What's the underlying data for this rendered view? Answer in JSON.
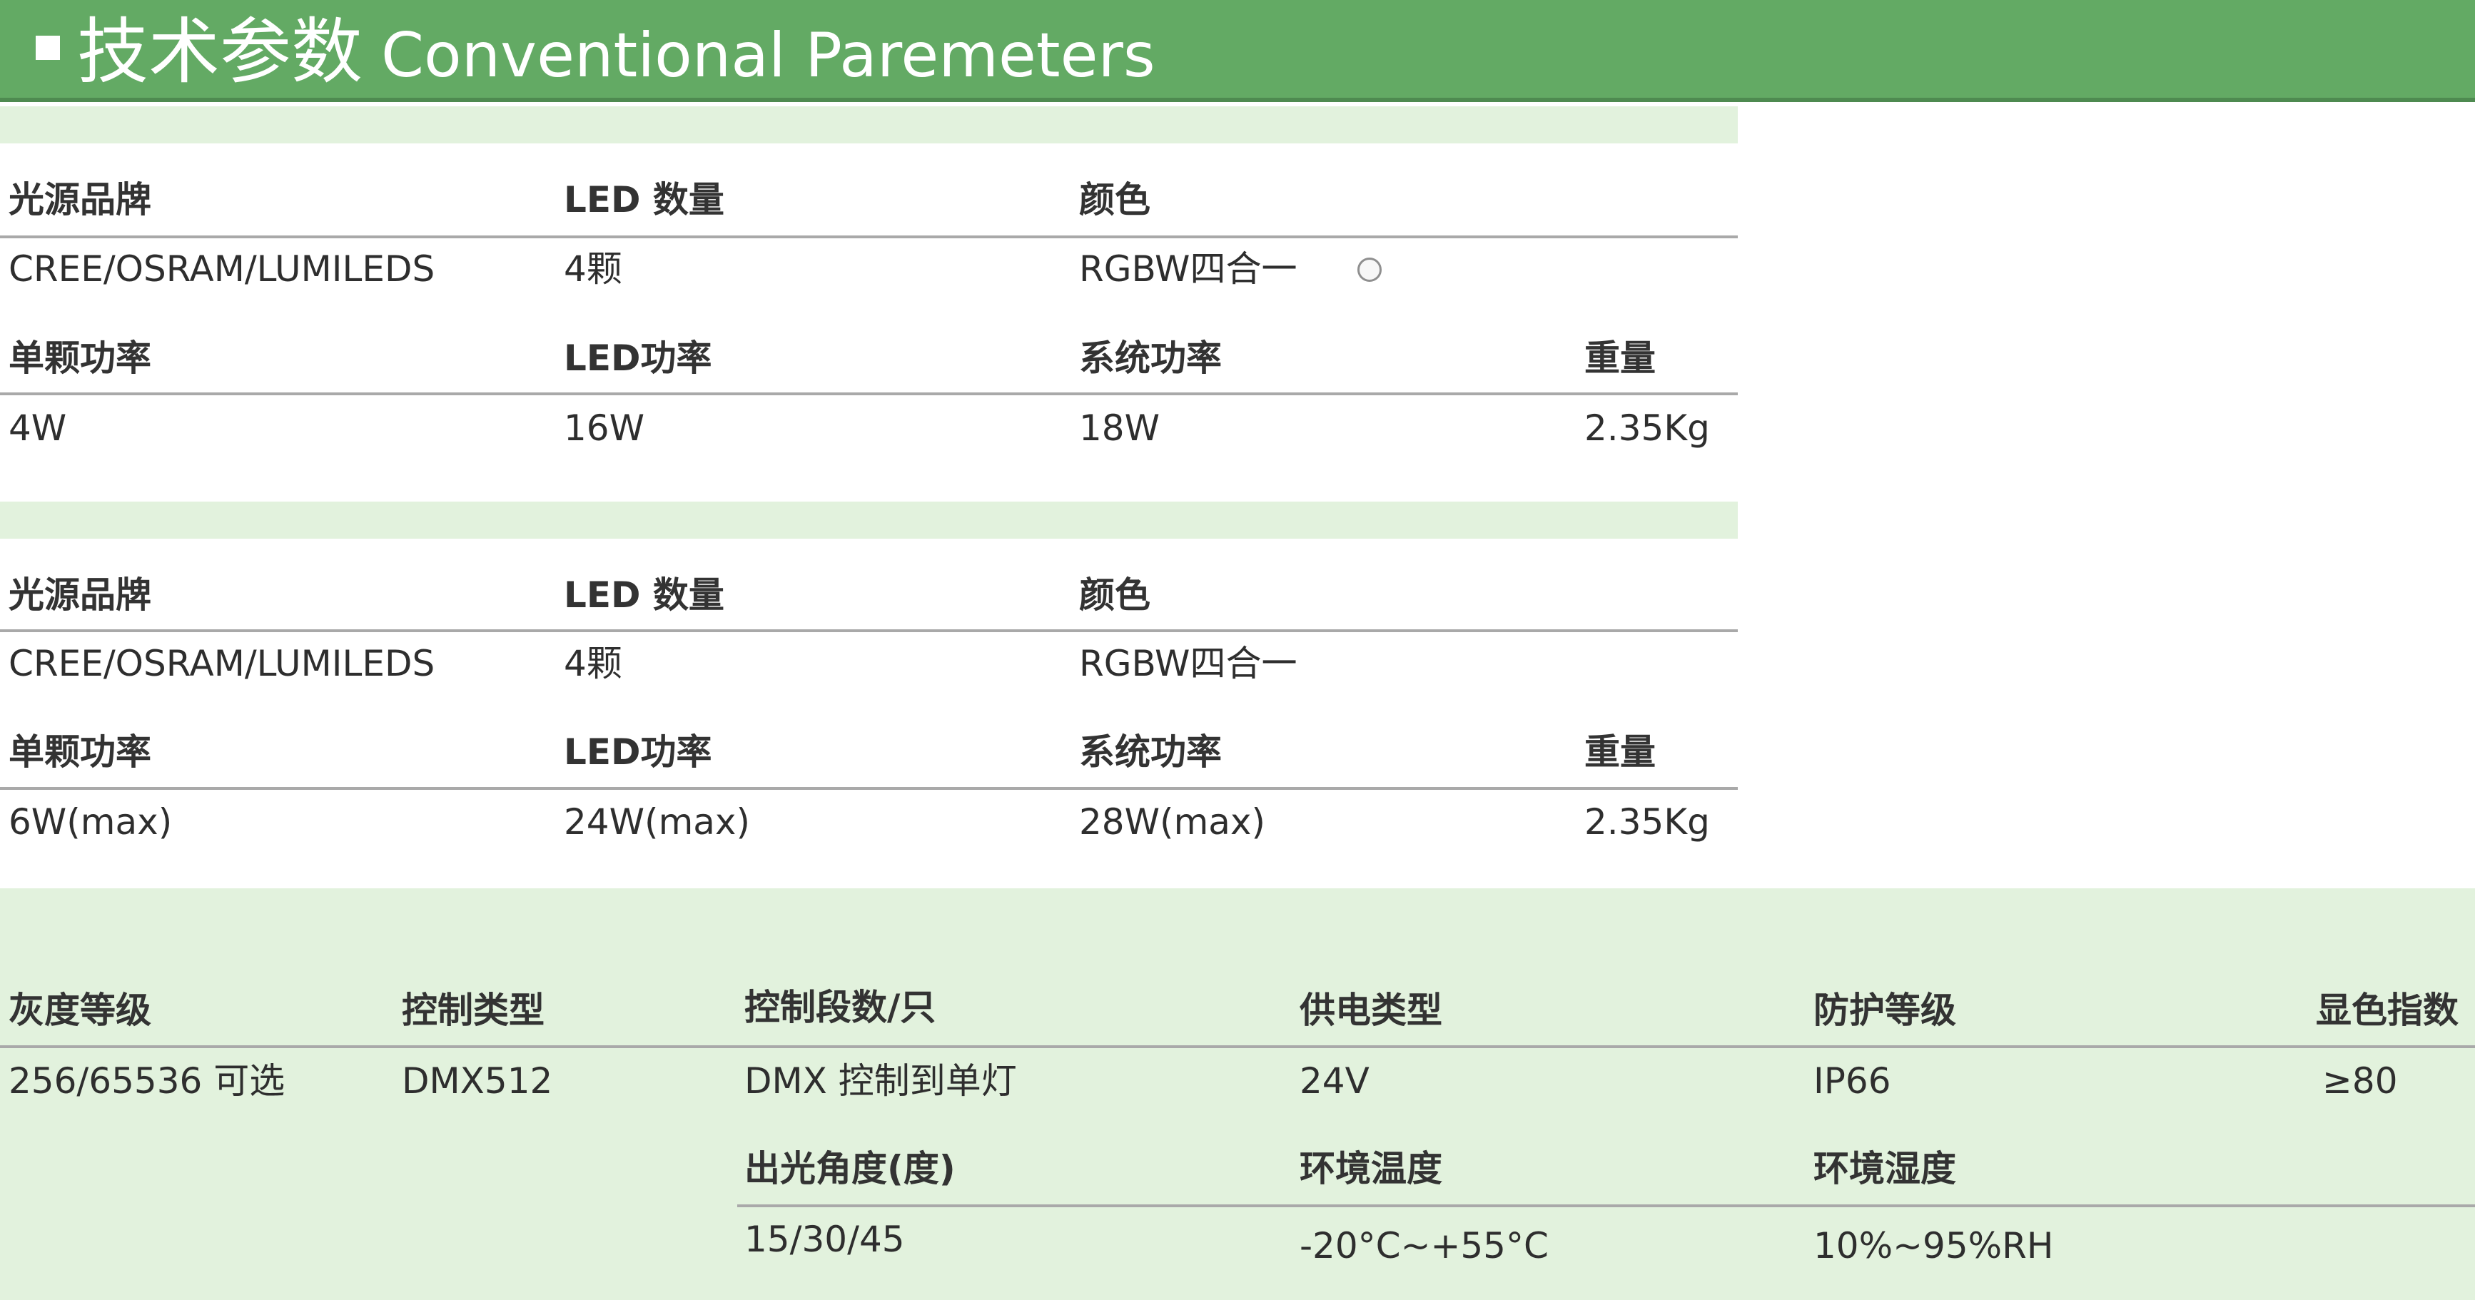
{
  "header": {
    "title_cn": "技术参数",
    "title_en": "Conventional Paremeters",
    "accent_color": "#63aa64"
  },
  "spec1": {
    "row1_headers": [
      "光源品牌",
      "LED 数量",
      "颜色"
    ],
    "row1_values": [
      "CREE/OSRAM/LUMILEDS",
      "4颗",
      "RGBW四合一"
    ],
    "row2_headers": [
      "单颗功率",
      "LED功率",
      "系统功率",
      "重量"
    ],
    "row2_values": [
      "4W",
      "16W",
      "18W",
      "2.35Kg"
    ]
  },
  "spec2": {
    "row1_headers": [
      "光源品牌",
      "LED 数量",
      "颜色"
    ],
    "row1_values": [
      "CREE/OSRAM/LUMILEDS",
      "4颗",
      "RGBW四合一"
    ],
    "row2_headers": [
      "单颗功率",
      "LED功率",
      "系统功率",
      "重量"
    ],
    "row2_values": [
      "6W(max)",
      "24W(max)",
      "28W(max)",
      "2.35Kg"
    ]
  },
  "spec3": {
    "row1_headers": [
      "灰度等级",
      "控制类型",
      "控制段数/只",
      "供电类型",
      "防护等级",
      "显色指数"
    ],
    "row1_values": [
      "256/65536 可选",
      "DMX512",
      "DMX 控制到单灯",
      "24V",
      "IP66",
      "≥80"
    ],
    "row2_headers": [
      "出光角度(度)",
      "环境温度",
      "环境湿度"
    ],
    "row2_values": [
      "15/30/45",
      "-20°C~+55°C",
      "10%~95%RH"
    ]
  }
}
